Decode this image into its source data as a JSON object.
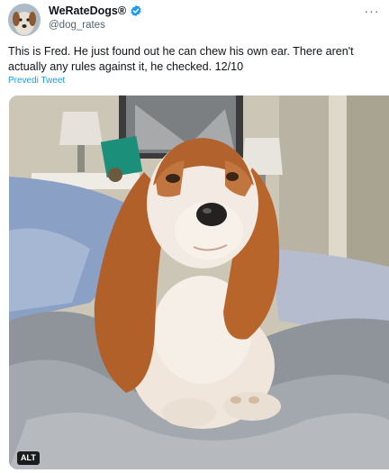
{
  "author": {
    "display_name": "WeRateDogs®",
    "handle": "@dog_rates",
    "avatar_icon": "dog-avatar-icon",
    "verified_icon": "verified-badge-icon",
    "verified_color": "#1d9bf0"
  },
  "menu": {
    "more_label": "···"
  },
  "tweet": {
    "text": "This is Fred. He just found out he can chew his own ear. There aren't actually any rules against it, he checked. 12/10",
    "translate_label": "Prevedi Tweet"
  },
  "media": {
    "alt_label": "ALT"
  },
  "colors": {
    "link": "#1d9bf0",
    "secondary_text": "#536471",
    "primary_text": "#0f1419"
  }
}
